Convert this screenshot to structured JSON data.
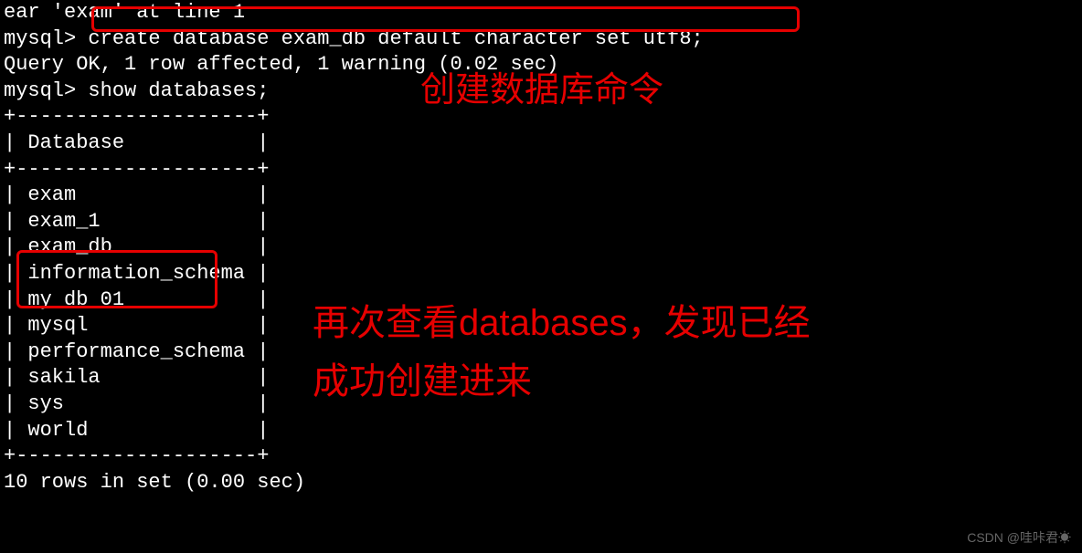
{
  "terminal": {
    "line0": "ear 'exam' at line 1",
    "prompt1": "mysql> ",
    "cmd1": "create database exam_db default character set utf8;",
    "result1": "Query OK, 1 row affected, 1 warning (0.02 sec)",
    "blank1": "",
    "prompt2": "mysql> ",
    "cmd2": "show databases;",
    "divider": "+--------------------+",
    "header": "| Database           |",
    "rows": [
      "| exam               |",
      "| exam_1             |",
      "| exam_db            |",
      "| information_schema |",
      "| my_db_01           |",
      "| mysql              |",
      "| performance_schema |",
      "| sakila             |",
      "| sys                |",
      "| world              |"
    ],
    "footer": "10 rows in set (0.00 sec)"
  },
  "annotations": {
    "label1": "创建数据库命令",
    "label2_line1": "再次查看databases，发现已经",
    "label2_line2": "成功创建进来"
  },
  "watermark": "CSDN @哇咔君☀"
}
